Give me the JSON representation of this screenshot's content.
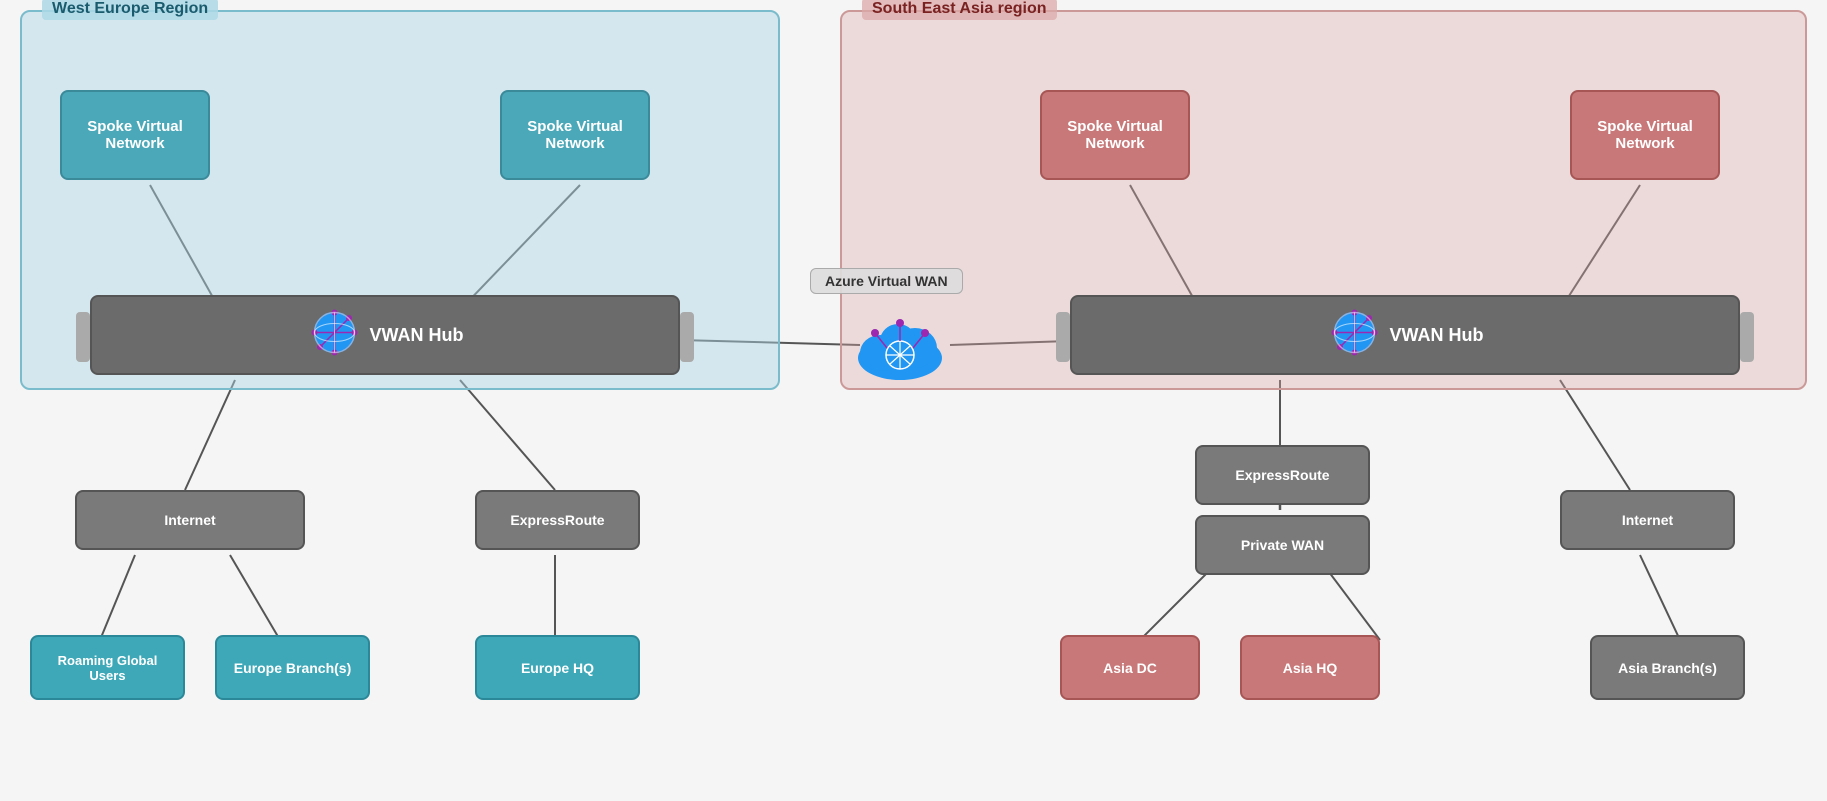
{
  "regions": {
    "west": {
      "label": "West Europe Region"
    },
    "asia": {
      "label": "South East Asia region"
    }
  },
  "west": {
    "spoke1": "Spoke Virtual\nNetwork",
    "spoke2": "Spoke Virtual\nNetwork",
    "hub": "VWAN Hub",
    "internet": "Internet",
    "expressroute": "ExpressRoute",
    "roaming": "Roaming Global\nUsers",
    "europe_branch": "Europe Branch(s)",
    "europe_hq": "Europe HQ"
  },
  "asia": {
    "spoke1": "Spoke Virtual\nNetwork",
    "spoke2": "Spoke Virtual\nNetwork",
    "hub": "VWAN Hub",
    "expressroute": "ExpressRoute",
    "private_wan": "Private WAN",
    "internet": "Internet",
    "asia_dc": "Asia DC",
    "asia_hq": "Asia HQ",
    "asia_branch": "Asia Branch(s)"
  },
  "center": {
    "azure_wan_label": "Azure Virtual WAN"
  }
}
